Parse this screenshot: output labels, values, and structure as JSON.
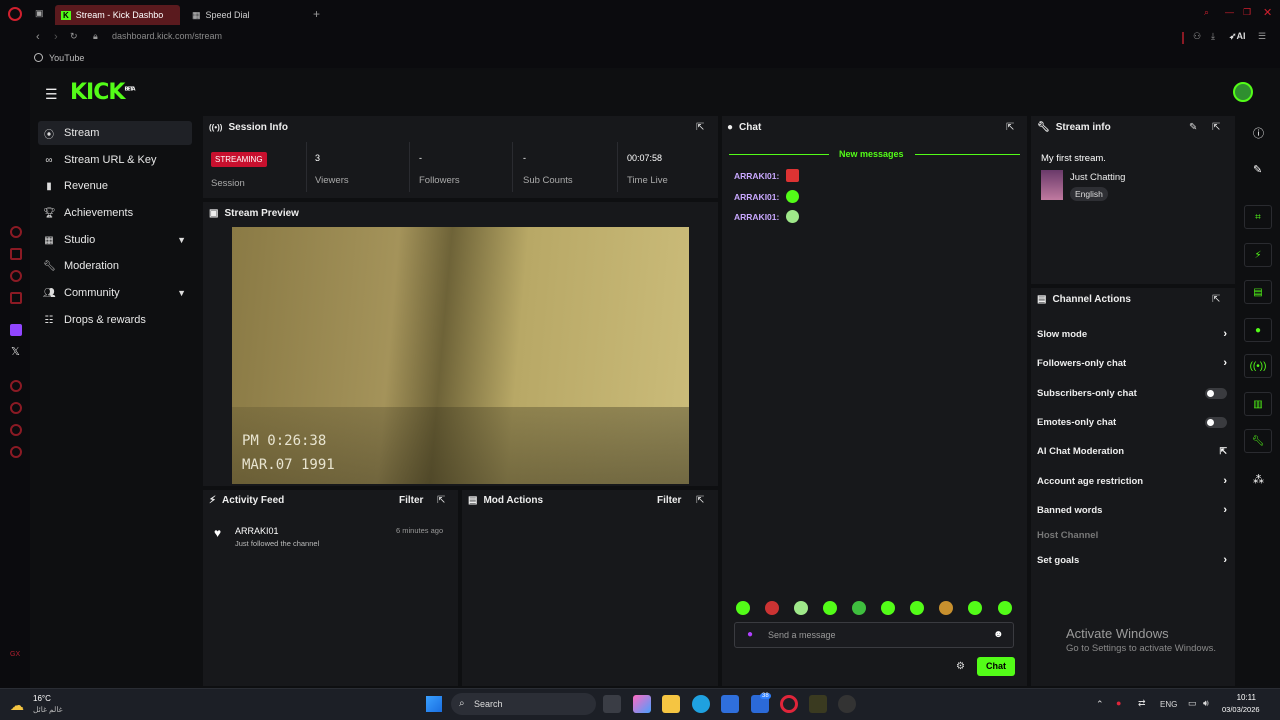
{
  "browser": {
    "tabs": [
      {
        "label": "Stream - Kick Dashbo"
      },
      {
        "label": "Speed Dial"
      }
    ],
    "url": "dashboard.kick.com/stream",
    "bookmark": "YouTube",
    "ai_label": "AI"
  },
  "app": {
    "logo": "KICK",
    "logo_sup": "BETA"
  },
  "nav": [
    {
      "label": "Stream",
      "icon": "stream-icon"
    },
    {
      "label": "Stream URL & Key",
      "icon": "link-icon"
    },
    {
      "label": "Revenue",
      "icon": "chart-icon"
    },
    {
      "label": "Achievements",
      "icon": "trophy-icon"
    },
    {
      "label": "Studio",
      "icon": "grid-icon"
    },
    {
      "label": "Moderation",
      "icon": "wrench-icon"
    },
    {
      "label": "Community",
      "icon": "people-icon"
    },
    {
      "label": "Drops & rewards",
      "icon": "drops-icon"
    }
  ],
  "session": {
    "title": "Session Info",
    "status": "STREAMING",
    "session_label": "Session",
    "stats": [
      {
        "value": "3",
        "label": "Viewers"
      },
      {
        "value": "-",
        "label": "Followers"
      },
      {
        "value": "-",
        "label": "Sub Counts"
      },
      {
        "value": "00:07:58",
        "label": "Time Live"
      }
    ]
  },
  "preview": {
    "title": "Stream Preview",
    "time": "PM  0:26:38",
    "date": "MAR.07 1991"
  },
  "activity": {
    "title": "Activity Feed",
    "filter": "Filter",
    "items": [
      {
        "user": "ARRAKI01",
        "text": "Just followed the channel",
        "time": "6 minutes ago"
      }
    ]
  },
  "mod": {
    "title": "Mod Actions",
    "filter": "Filter"
  },
  "chat": {
    "title": "Chat",
    "new_messages": "New messages",
    "messages": [
      {
        "user": "ARRAKI01:"
      },
      {
        "user": "ARRAKI01:"
      },
      {
        "user": "ARRAKI01:"
      }
    ],
    "placeholder": "Send a message",
    "send": "Chat"
  },
  "stream_info": {
    "title": "Stream info",
    "stream_title": "My first stream.",
    "category": "Just Chatting",
    "language": "English"
  },
  "channel_actions": {
    "title": "Channel Actions",
    "items": [
      {
        "label": "Slow mode",
        "control": "arrow"
      },
      {
        "label": "Followers-only chat",
        "control": "arrow"
      },
      {
        "label": "Subscribers-only chat",
        "control": "toggle"
      },
      {
        "label": "Emotes-only chat",
        "control": "toggle"
      },
      {
        "label": "AI Chat Moderation",
        "control": "external"
      },
      {
        "label": "Account age restriction",
        "control": "arrow"
      },
      {
        "label": "Banned words",
        "control": "arrow"
      },
      {
        "label": "Host Channel",
        "control": "none"
      },
      {
        "label": "Set goals",
        "control": "arrow"
      }
    ]
  },
  "watermark": {
    "line1": "Activate Windows",
    "line2": "Go to Settings to activate Windows."
  },
  "taskbar": {
    "weather_temp": "16°C",
    "weather_text": "غالم غائل",
    "search": "Search",
    "lang": "ENG",
    "time": "10:11",
    "date": "03/03/2026",
    "badge": "38"
  },
  "colors": {
    "accent": "#53fc18",
    "live": "#c8102e",
    "panel": "#17181b"
  }
}
